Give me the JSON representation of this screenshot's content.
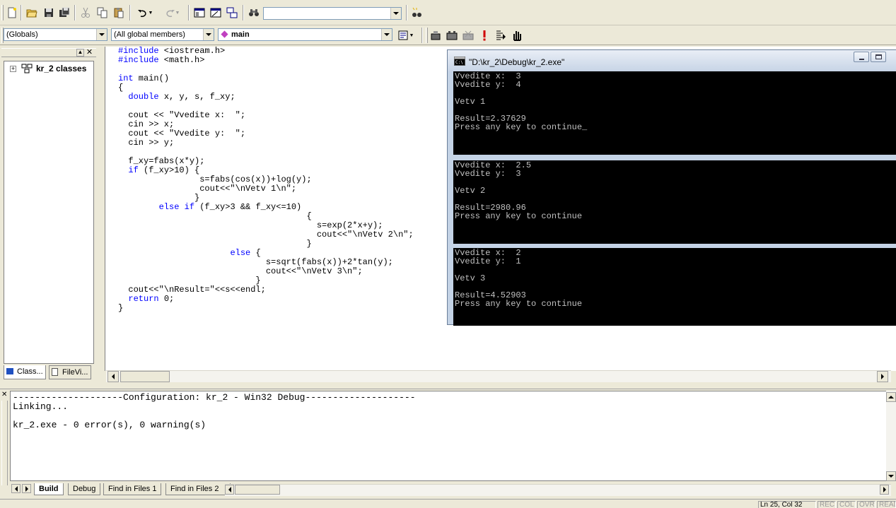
{
  "toolbar": {
    "find_combo_value": "",
    "scope_combo": "(Globals)",
    "members_combo": "(All global members)",
    "function_combo": "main"
  },
  "workspace": {
    "tree_root": "kr_2 classes",
    "tabs": [
      {
        "label": "Class..."
      },
      {
        "label": "FileVi..."
      }
    ]
  },
  "editor": {
    "lines": [
      "#include <iostream.h>",
      "#include <math.h>",
      "",
      "int main()",
      "{",
      "  double x, y, s, f_xy;",
      "",
      "  cout << \"Vvedite x:  \";",
      "  cin >> x;",
      "  cout << \"Vvedite y:  \";",
      "  cin >> y;",
      "",
      "  f_xy=fabs(x*y);",
      "  if (f_xy>10) {",
      "                s=fabs(cos(x))+log(y);",
      "                cout<<\"\\nVetv 1\\n\";",
      "               }",
      "        else if (f_xy>3 && f_xy<=10)",
      "                                     {",
      "                                       s=exp(2*x+y);",
      "                                       cout<<\"\\nVetv 2\\n\";",
      "                                     }",
      "                      else {",
      "                             s=sqrt(fabs(x))+2*tan(y);",
      "                             cout<<\"\\nVetv 3\\n\";",
      "                           }",
      "  cout<<\"\\nResult=\"<<s<<endl;",
      "  return 0;",
      "}"
    ]
  },
  "console": {
    "title": "\"D:\\kr_2\\Debug\\kr_2.exe\"",
    "runs": [
      "Vvedite x:  3\nVvedite y:  4\n\nVetv 1\n\nResult=2.37629\nPress any key to continue_",
      "Vvedite x:  2.5\nVvedite y:  3\n\nVetv 2\n\nResult=2980.96\nPress any key to continue",
      "Vvedite x:  2\nVvedite y:  1\n\nVetv 3\n\nResult=4.52903\nPress any key to continue"
    ]
  },
  "output": {
    "text": "--------------------Configuration: kr_2 - Win32 Debug--------------------\nLinking...\n\nkr_2.exe - 0 error(s), 0 warning(s)",
    "tabs": [
      {
        "label": "Build"
      },
      {
        "label": "Debug"
      },
      {
        "label": "Find in Files 1"
      },
      {
        "label": "Find in Files 2"
      }
    ]
  },
  "status": {
    "position": "Ln 25, Col 32",
    "rec": "REC",
    "col": "COL",
    "ovr": "OVR",
    "read": "READ"
  },
  "colors": {
    "keyword": "#0000ff",
    "console_bg": "#000000",
    "console_text": "#c0c0c0"
  }
}
